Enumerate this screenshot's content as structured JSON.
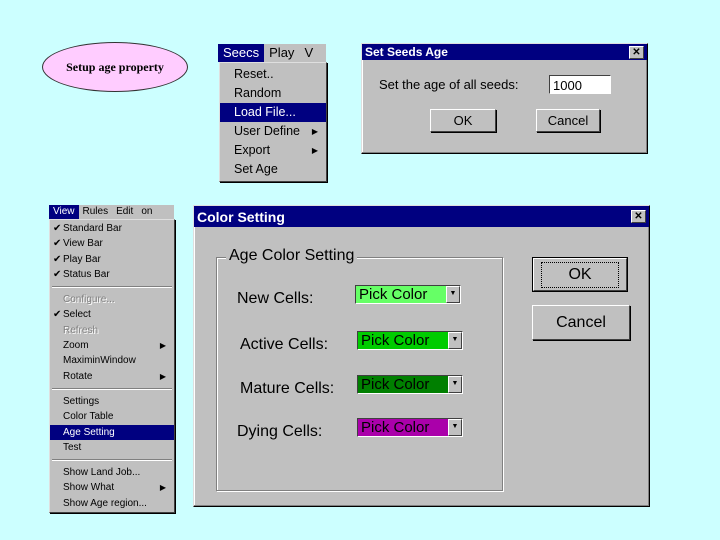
{
  "callout": {
    "text": "Setup age property"
  },
  "seeds_menu": {
    "menubar": [
      "Seecs",
      "Play",
      "V"
    ],
    "active_index": 0,
    "items": [
      {
        "label": "Reset..",
        "state": "normal"
      },
      {
        "label": "Random",
        "state": "normal"
      },
      {
        "label": "Load File...",
        "state": "selected"
      },
      {
        "label": "User Define",
        "state": "normal",
        "submenu": true
      },
      {
        "label": "Export",
        "state": "normal",
        "submenu": true
      },
      {
        "label": "Set Age",
        "state": "normal"
      }
    ]
  },
  "seeds_dialog": {
    "title": "Set Seeds Age",
    "close_glyph": "✕",
    "prompt": "Set the age of all seeds:",
    "age_value": "1000",
    "ok_label": "OK",
    "cancel_label": "Cancel"
  },
  "view_menu": {
    "menubar": [
      "View",
      "Rules",
      "Edit",
      "on"
    ],
    "active_index": 0,
    "items": [
      {
        "label": "Standard Bar",
        "checked": true
      },
      {
        "label": "View Bar",
        "checked": true
      },
      {
        "label": "Play Bar",
        "checked": true
      },
      {
        "label": "Status Bar",
        "checked": true
      },
      {
        "separator": true
      },
      {
        "label": "Configure...",
        "disabled": true
      },
      {
        "label": "Select",
        "checked": true
      },
      {
        "label": "Refresh",
        "disabled": true
      },
      {
        "label": "Zoom",
        "submenu": true
      },
      {
        "label": "MaximinWindow"
      },
      {
        "label": "Rotate",
        "submenu": true
      },
      {
        "separator": true
      },
      {
        "label": "Settings"
      },
      {
        "label": "Color Table"
      },
      {
        "label": "Age Setting",
        "selected": true
      },
      {
        "label": "Test"
      },
      {
        "separator": true
      },
      {
        "label": "Show Land Job..."
      },
      {
        "label": "Show What",
        "submenu": true
      },
      {
        "label": "Show Age region..."
      }
    ]
  },
  "color_dialog": {
    "title": "Color Setting",
    "close_glyph": "✕",
    "group_title": "Age Color Setting",
    "rows": [
      {
        "label": "New Cells:",
        "button": "Pick Color",
        "color": "#66ff66"
      },
      {
        "label": "Active Cells:",
        "button": "Pick Color",
        "color": "#00cc00"
      },
      {
        "label": "Mature Cells:",
        "button": "Pick Color",
        "color": "#007f00"
      },
      {
        "label": "Dying Cells:",
        "button": "Pick Color",
        "color": "#aa00aa"
      }
    ],
    "ok_label": "OK",
    "cancel_label": "Cancel"
  },
  "icons": {
    "check": "✔",
    "submenu_arrow": "▶",
    "dropdown_arrow": "▼"
  }
}
